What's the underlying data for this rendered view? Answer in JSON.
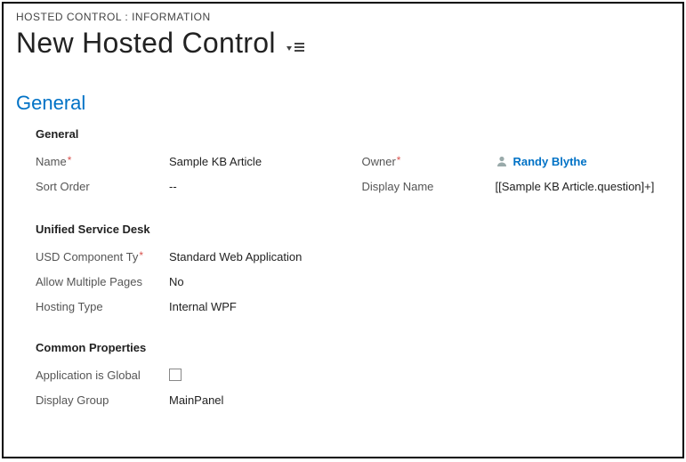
{
  "breadcrumb": "HOSTED CONTROL : INFORMATION",
  "page_title": "New Hosted Control",
  "section_title": "General",
  "subsections": {
    "general": {
      "header": "General",
      "name_label": "Name",
      "name_value": "Sample KB Article",
      "sort_order_label": "Sort Order",
      "sort_order_value": "--",
      "owner_label": "Owner",
      "owner_value": "Randy Blythe",
      "display_name_label": "Display Name",
      "display_name_value": "[[Sample KB Article.question]+]"
    },
    "usd": {
      "header": "Unified Service Desk",
      "component_type_label": "USD Component Ty",
      "component_type_value": "Standard Web Application",
      "allow_multi_label": "Allow Multiple Pages",
      "allow_multi_value": "No",
      "hosting_type_label": "Hosting Type",
      "hosting_type_value": "Internal WPF"
    },
    "common": {
      "header": "Common Properties",
      "app_global_label": "Application is Global",
      "display_group_label": "Display Group",
      "display_group_value": "MainPanel"
    }
  }
}
